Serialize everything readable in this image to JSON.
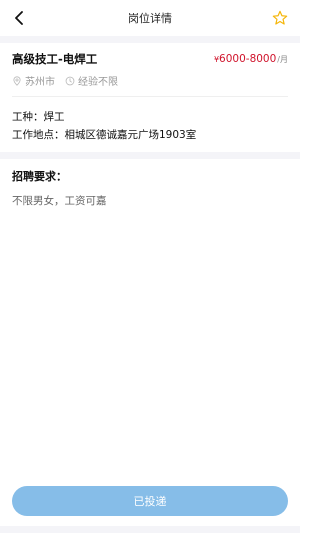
{
  "header": {
    "title": "岗位详情",
    "back_icon": "back-arrow-icon",
    "favorite_icon": "star-icon",
    "accent_color": "#f5b60a"
  },
  "job": {
    "title": "高级技工-电焊工",
    "salary_currency": "¥",
    "salary_min": "6000",
    "salary_range_sep": " -",
    "salary_max": "8000",
    "salary_unit": "/月",
    "salary_color": "#d0142c",
    "location": "苏州市",
    "experience": "经验不限",
    "type_label": "工种：",
    "type_value": "焊工",
    "address_label": "工作地点：",
    "address_value": "相城区德诚嘉元广场1903室"
  },
  "requirements": {
    "title": "招聘要求：",
    "text": "不限男女，工资可嘉"
  },
  "actions": {
    "submit_label": "已投递",
    "submit_color": "#86bde8"
  }
}
